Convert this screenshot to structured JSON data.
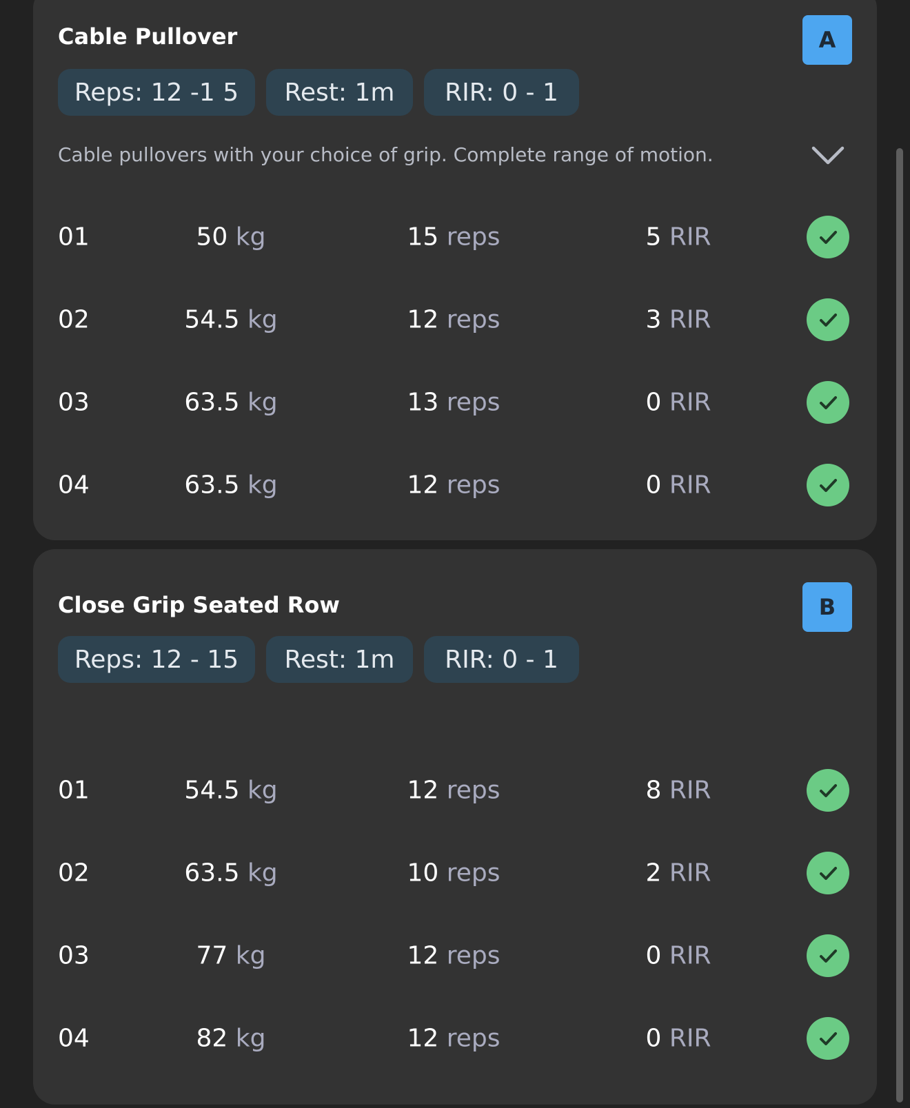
{
  "exercises": [
    {
      "badge": "A",
      "title": "Cable Pullover",
      "chips": {
        "reps": "Reps: 12 -1 5",
        "rest": "Rest: 1m",
        "rir": "RIR: 0 - 1"
      },
      "description": "Cable pullovers with your choice of grip. Complete range of motion.",
      "sets": [
        {
          "num": "01",
          "weight": "50",
          "weight_unit": "kg",
          "reps": "15",
          "reps_unit": "reps",
          "rir": "5",
          "rir_unit": "RIR"
        },
        {
          "num": "02",
          "weight": "54.5",
          "weight_unit": "kg",
          "reps": "12",
          "reps_unit": "reps",
          "rir": "3",
          "rir_unit": "RIR"
        },
        {
          "num": "03",
          "weight": "63.5",
          "weight_unit": "kg",
          "reps": "13",
          "reps_unit": "reps",
          "rir": "0",
          "rir_unit": "RIR"
        },
        {
          "num": "04",
          "weight": "63.5",
          "weight_unit": "kg",
          "reps": "12",
          "reps_unit": "reps",
          "rir": "0",
          "rir_unit": "RIR"
        }
      ]
    },
    {
      "badge": "B",
      "title": "Close Grip Seated Row",
      "chips": {
        "reps": "Reps: 12 - 15",
        "rest": "Rest: 1m",
        "rir": "RIR: 0 - 1"
      },
      "sets": [
        {
          "num": "01",
          "weight": "54.5",
          "weight_unit": "kg",
          "reps": "12",
          "reps_unit": "reps",
          "rir": "8",
          "rir_unit": "RIR"
        },
        {
          "num": "02",
          "weight": "63.5",
          "weight_unit": "kg",
          "reps": "10",
          "reps_unit": "reps",
          "rir": "2",
          "rir_unit": "RIR"
        },
        {
          "num": "03",
          "weight": "77",
          "weight_unit": "kg",
          "reps": "12",
          "reps_unit": "reps",
          "rir": "0",
          "rir_unit": "RIR"
        },
        {
          "num": "04",
          "weight": "82",
          "weight_unit": "kg",
          "reps": "12",
          "reps_unit": "reps",
          "rir": "0",
          "rir_unit": "RIR"
        }
      ]
    }
  ],
  "icons": {
    "expand": "chevron-down-icon",
    "completed": "check-circle-icon"
  },
  "colors": {
    "background": "#222222",
    "card": "#333333",
    "chip": "#2e4350",
    "badge": "#4da6f0",
    "check": "#6bcb85",
    "unit_text": "#a9abbf"
  }
}
